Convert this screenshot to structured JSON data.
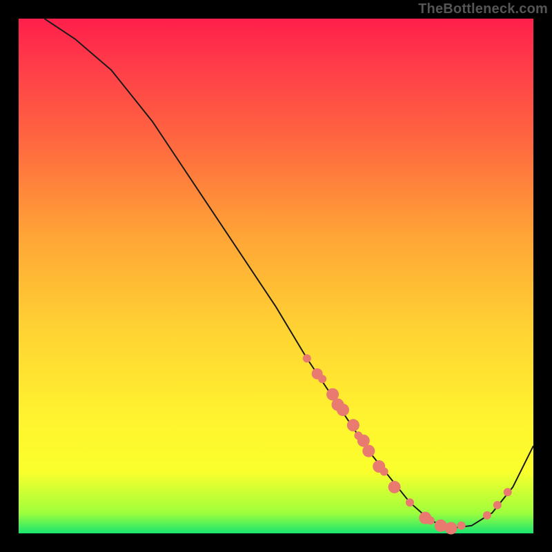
{
  "watermark": "TheBottleneck.com",
  "chart_data": {
    "type": "line",
    "title": "",
    "xlabel": "",
    "ylabel": "",
    "xlim": [
      0,
      100
    ],
    "ylim": [
      0,
      100
    ],
    "series": [
      {
        "name": "curve",
        "x": [
          5,
          11,
          18,
          26,
          34,
          42,
          50,
          56,
          60,
          64,
          68,
          72,
          76,
          80,
          84,
          88,
          92,
          96,
          100
        ],
        "values": [
          100,
          96,
          90,
          80,
          68,
          56,
          44,
          34,
          28,
          22,
          16,
          11,
          6,
          2.5,
          1,
          1.5,
          4,
          9,
          17
        ]
      }
    ],
    "markers": {
      "comment": "salmon dots along the curve, clustered on descending and on right rising limb",
      "x": [
        56,
        58,
        59,
        61,
        62,
        63,
        65,
        66,
        67,
        68,
        70,
        71,
        73,
        76,
        79,
        80,
        82,
        84,
        86,
        91,
        93,
        95
      ],
      "values": [
        34,
        31,
        30,
        27,
        25,
        24,
        21,
        19,
        18,
        16,
        13,
        12,
        9,
        6,
        3,
        2.5,
        1.5,
        1,
        1.5,
        3.5,
        5.5,
        8
      ],
      "radius": [
        6,
        8,
        6,
        9,
        9,
        9,
        9,
        6,
        9,
        9,
        9,
        6,
        9,
        6,
        9,
        6,
        9,
        9,
        6,
        6,
        6,
        6
      ],
      "color": "#e87a6f"
    },
    "curve_stroke": "#1a1a1a",
    "curve_width": 2
  }
}
